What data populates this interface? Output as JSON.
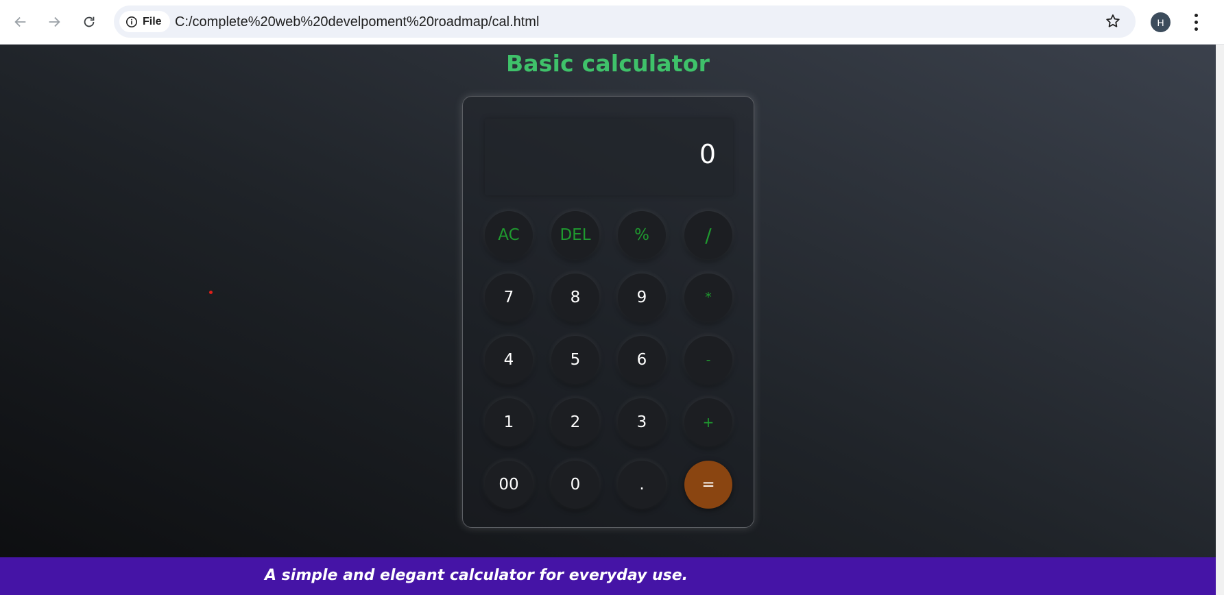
{
  "browser": {
    "site_chip_label": "File",
    "url": "C:/complete%20web%20develpoment%20roadmap/cal.html",
    "profile_initial": "H"
  },
  "page": {
    "title": "Basic calculator",
    "footer_text": "A simple and elegant calculator for everyday use."
  },
  "calculator": {
    "display_value": "0",
    "keys": [
      [
        "AC",
        "DEL",
        "%",
        "/"
      ],
      [
        "7",
        "8",
        "9",
        "*"
      ],
      [
        "4",
        "5",
        "6",
        "-"
      ],
      [
        "1",
        "2",
        "3",
        "+"
      ],
      [
        "00",
        "0",
        ".",
        "="
      ]
    ],
    "colors": {
      "accent": "#3fc26a",
      "operator": "#1f9a2f",
      "equals": "#8a4511",
      "footer": "#4514a6"
    }
  }
}
